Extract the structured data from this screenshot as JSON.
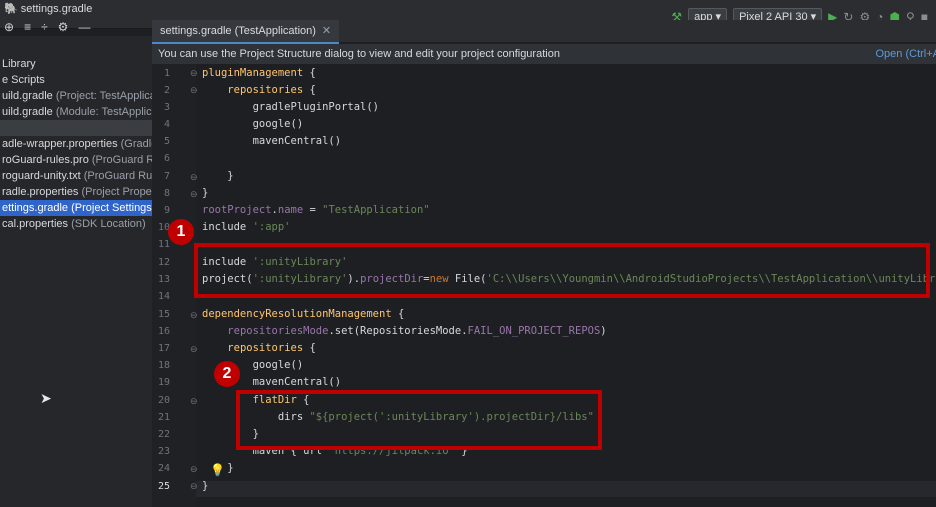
{
  "titlebar": {
    "file": "settings.gradle"
  },
  "run": {
    "config": "app ▾",
    "device": "Pixel 2 API 30 ▾"
  },
  "tab": {
    "label": "settings.gradle (TestApplication)"
  },
  "banner": {
    "message": "You can use the Project Structure dialog to view and edit your project configuration",
    "link": "Open (Ctrl+A"
  },
  "sidebar": {
    "items": [
      {
        "name": "Library",
        "sub": ""
      },
      {
        "name": "e Scripts",
        "sub": ""
      },
      {
        "name": "uild.gradle",
        "sub": " (Project: TestApplicatio"
      },
      {
        "name": "uild.gradle",
        "sub": " (Module: TestApplicat"
      },
      {
        "name": "",
        "sub": ""
      },
      {
        "name": "adle-wrapper.properties",
        "sub": " (Gradle "
      },
      {
        "name": "roGuard-rules.pro",
        "sub": " (ProGuard Rule"
      },
      {
        "name": "roguard-unity.txt",
        "sub": " (ProGuard Rules"
      },
      {
        "name": "radle.properties",
        "sub": " (Project Propertie"
      },
      {
        "name": "ettings.gradle",
        "sub": " (Project Settings)"
      },
      {
        "name": "cal.properties",
        "sub": " (SDK Location)"
      }
    ]
  },
  "editor": {
    "line_numbers": [
      "1",
      "2",
      "3",
      "4",
      "5",
      "6",
      "7",
      "8",
      "9",
      "10",
      "11",
      "12",
      "13",
      "14",
      "15",
      "16",
      "17",
      "18",
      "19",
      "20",
      "21",
      "22",
      "23",
      "24",
      "25"
    ],
    "current_line": "25"
  },
  "annotations": [
    {
      "label": "1"
    },
    {
      "label": "2"
    }
  ],
  "colors": {
    "accent": "#c00000",
    "selection": "#2f65ca"
  }
}
